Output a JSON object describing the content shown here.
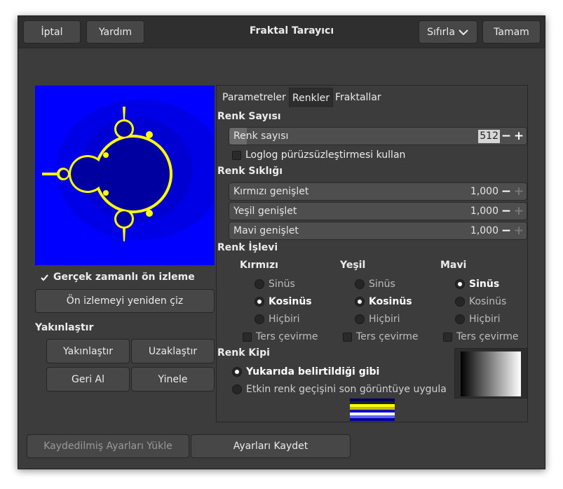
{
  "window": {
    "title": "Fraktal Tarayıcı"
  },
  "header": {
    "cancel": "İptal",
    "help": "Yardım",
    "reset": "Sıfırla",
    "ok": "Tamam"
  },
  "left": {
    "realtime_preview": "Gerçek zamanlı ön izleme",
    "redraw_preview": "Ön izlemeyi yeniden çiz",
    "zoom_title": "Yakınlaştır",
    "zoom_in": "Yakınlaştır",
    "zoom_out": "Uzaklaştır",
    "undo": "Geri Al",
    "redo": "Yinele"
  },
  "tabs": [
    "Parametreler",
    "Renkler",
    "Fraktallar"
  ],
  "color_count": {
    "title": "Renk Sayısı",
    "label": "Renk sayısı",
    "value": "512",
    "loglog": "Loglog pürüzsüzleştirmesi kullan"
  },
  "color_density": {
    "title": "Renk Sıklığı",
    "red_label": "Kırmızı genişlet",
    "red_value": "1,000",
    "green_label": "Yeşil genişlet",
    "green_value": "1,000",
    "blue_label": "Mavi genişlet",
    "blue_value": "1,000"
  },
  "color_function": {
    "title": "Renk İşlevi",
    "red": {
      "title": "Kırmızı",
      "sin": "Sinüs",
      "cos": "Kosinüs",
      "none": "Hiçbiri",
      "invert": "Ters çevirme"
    },
    "green": {
      "title": "Yeşil",
      "sin": "Sinüs",
      "cos": "Kosinüs",
      "none": "Hiçbiri",
      "invert": "Ters çevirme"
    },
    "blue": {
      "title": "Mavi",
      "sin": "Sinüs",
      "cos": "Kosinüs",
      "none": "Hiçbiri",
      "invert": "Ters çevirme"
    }
  },
  "color_mode": {
    "title": "Renk Kipi",
    "as_specified": "Yukarıda belirtildiği gibi",
    "apply_gradient": "Etkin renk geçişini son görüntüye uygula"
  },
  "footer": {
    "load": "Kaydedilmiş Ayarları Yükle",
    "save": "Ayarları Kaydet"
  },
  "colors": {
    "dialog_bg": "#3c3c3c",
    "preview_bg": "#0000ff",
    "fractal_body": "#0000a0",
    "fractal_edge": "#ffff00"
  }
}
